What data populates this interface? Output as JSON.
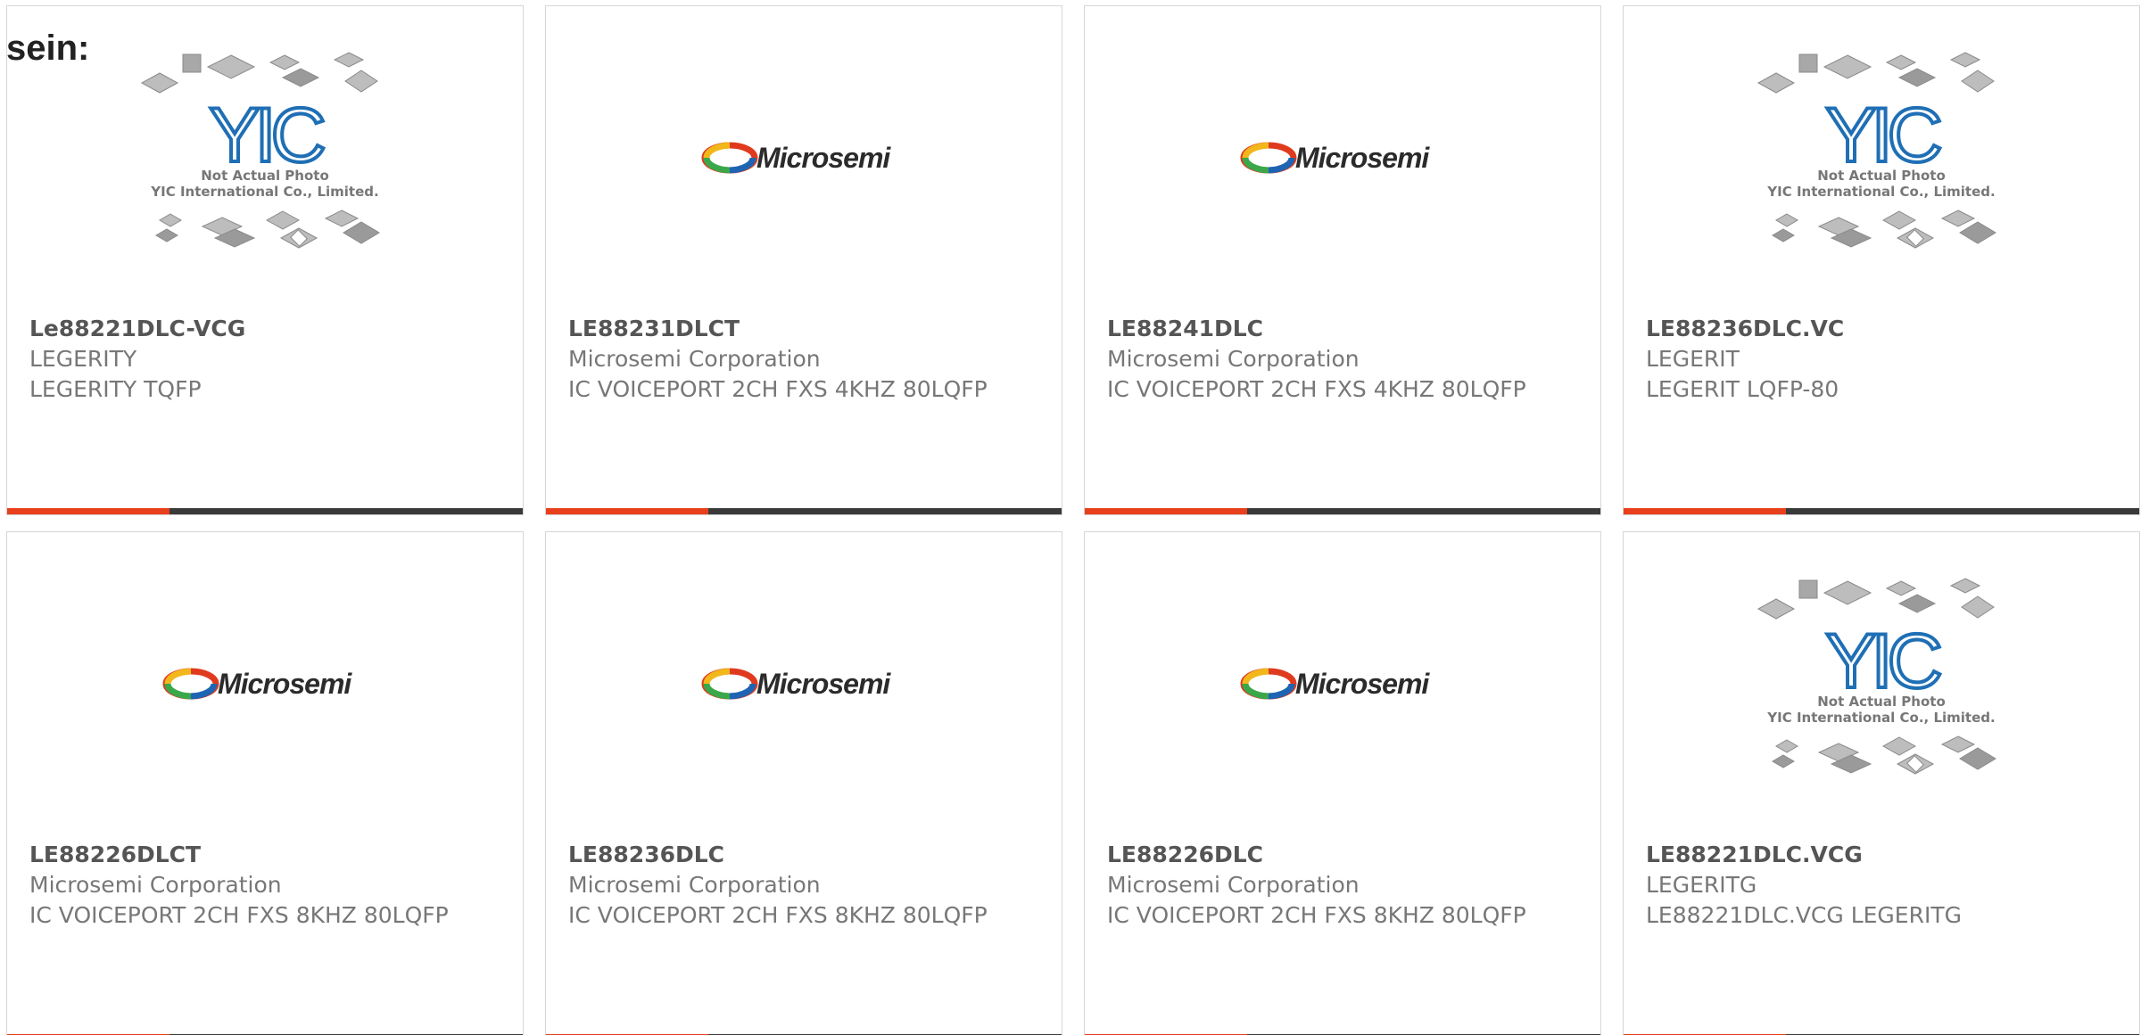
{
  "heading": "sein:",
  "colors": {
    "accent": "#e8401c",
    "bar": "#3a3a3a",
    "yic_blue": "#1f6fb5",
    "microsemi_red": "#e03a1e",
    "microsemi_yellow": "#f2b71b",
    "microsemi_green": "#3aa84a",
    "microsemi_blue": "#1d64b3"
  },
  "logos": {
    "yic": {
      "mark": "YIC",
      "line1": "Not Actual Photo",
      "line2": "YIC International Co., Limited."
    },
    "microsemi": {
      "wordmark": "Microsemi"
    }
  },
  "products": [
    {
      "part_number": "Le88221DLC-VCG",
      "manufacturer": "LEGERITY",
      "description": "LEGERITY TQFP",
      "image": "yic-placeholder"
    },
    {
      "part_number": "LE88231DLCT",
      "manufacturer": "Microsemi Corporation",
      "description": "IC VOICEPORT 2CH FXS 4KHZ 80LQFP",
      "image": "microsemi-logo"
    },
    {
      "part_number": "LE88241DLC",
      "manufacturer": "Microsemi Corporation",
      "description": "IC VOICEPORT 2CH FXS 4KHZ 80LQFP",
      "image": "microsemi-logo"
    },
    {
      "part_number": "LE88236DLC.VC",
      "manufacturer": "LEGERIT",
      "description": "LEGERIT LQFP-80",
      "image": "yic-placeholder"
    },
    {
      "part_number": "LE88226DLCT",
      "manufacturer": "Microsemi Corporation",
      "description": "IC VOICEPORT 2CH FXS 8KHZ 80LQFP",
      "image": "microsemi-logo"
    },
    {
      "part_number": "LE88236DLC",
      "manufacturer": "Microsemi Corporation",
      "description": "IC VOICEPORT 2CH FXS 8KHZ 80LQFP",
      "image": "microsemi-logo"
    },
    {
      "part_number": "LE88226DLC",
      "manufacturer": "Microsemi Corporation",
      "description": "IC VOICEPORT 2CH FXS 8KHZ 80LQFP",
      "image": "microsemi-logo"
    },
    {
      "part_number": "LE88221DLC.VCG",
      "manufacturer": "LEGERITG",
      "description": "LE88221DLC.VCG LEGERITG",
      "image": "yic-placeholder"
    }
  ]
}
